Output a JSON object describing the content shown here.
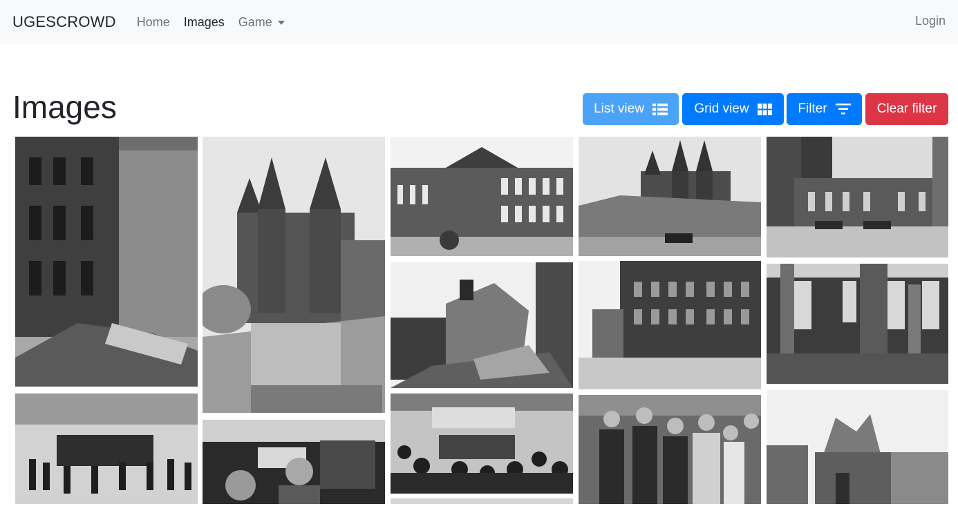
{
  "navbar": {
    "brand": "UGESCROWD",
    "items": [
      {
        "label": "Home"
      },
      {
        "label": "Images"
      },
      {
        "label": "Game"
      }
    ],
    "login": "Login"
  },
  "page": {
    "title": "Images"
  },
  "toolbar": {
    "list_view": "List view",
    "grid_view": "Grid view",
    "filter": "Filter",
    "clear_filter": "Clear filter"
  },
  "colors": {
    "navbar_bg": "#f8f9fa",
    "primary": "#007bff",
    "primary_light": "#4ba3f7",
    "danger": "#dc3545"
  },
  "icons": {
    "list_view": "list-icon",
    "grid_view": "grid-icon",
    "filter": "filter-icon",
    "game_dropdown": "caret-down-icon"
  }
}
